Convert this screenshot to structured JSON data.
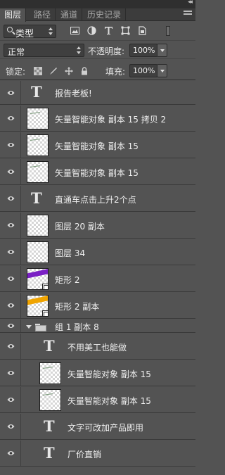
{
  "panel": {
    "collapse_glyph": "◂◂",
    "tabs": [
      "图层",
      "路径",
      "通道",
      "历史记录"
    ],
    "active_tab": 0
  },
  "filter": {
    "kind_label": "类型",
    "icons": [
      "image-filter-icon",
      "adjustment-filter-icon",
      "type-filter-icon",
      "shape-filter-icon",
      "smart-object-filter-icon"
    ]
  },
  "blend": {
    "mode": "正常",
    "opacity_label": "不透明度:",
    "opacity_value": "100%"
  },
  "lock": {
    "label": "锁定:",
    "fill_label": "填充:",
    "fill_value": "100%",
    "icons": [
      "lock-transparent-icon",
      "lock-image-icon",
      "lock-position-icon",
      "lock-all-icon"
    ]
  },
  "layers": [
    {
      "name": "报告老板!",
      "kind": "text"
    },
    {
      "name": "矢量智能对象 副本 15 拷贝 2",
      "kind": "smart"
    },
    {
      "name": "矢量智能对象 副本 15",
      "kind": "smart"
    },
    {
      "name": "矢量智能对象 副本 15",
      "kind": "smart"
    },
    {
      "name": "直通车点击上升2个点",
      "kind": "text"
    },
    {
      "name": "图层 20 副本",
      "kind": "pixel"
    },
    {
      "name": "图层 34",
      "kind": "pixel"
    },
    {
      "name": "矩形 2",
      "kind": "shape",
      "accent": "#7a1fc4"
    },
    {
      "name": "矩形 2 副本",
      "kind": "shape",
      "accent": "#f0a400"
    },
    {
      "name": "组 1 副本 8",
      "kind": "group",
      "expanded": true
    },
    {
      "name": "不用美工也能做",
      "kind": "text",
      "indent": true
    },
    {
      "name": "矢量智能对象 副本 15",
      "kind": "smart",
      "indent": true
    },
    {
      "name": "矢量智能对象 副本 15",
      "kind": "smart",
      "indent": true
    },
    {
      "name": "文字可改加产品即用",
      "kind": "text",
      "indent": true
    },
    {
      "name": "厂价直销",
      "kind": "text",
      "indent": true
    }
  ],
  "colors": {
    "panel_bg": "#535353",
    "tab_bar": "#3c3c3c",
    "field_bg": "#3f3f3f"
  }
}
